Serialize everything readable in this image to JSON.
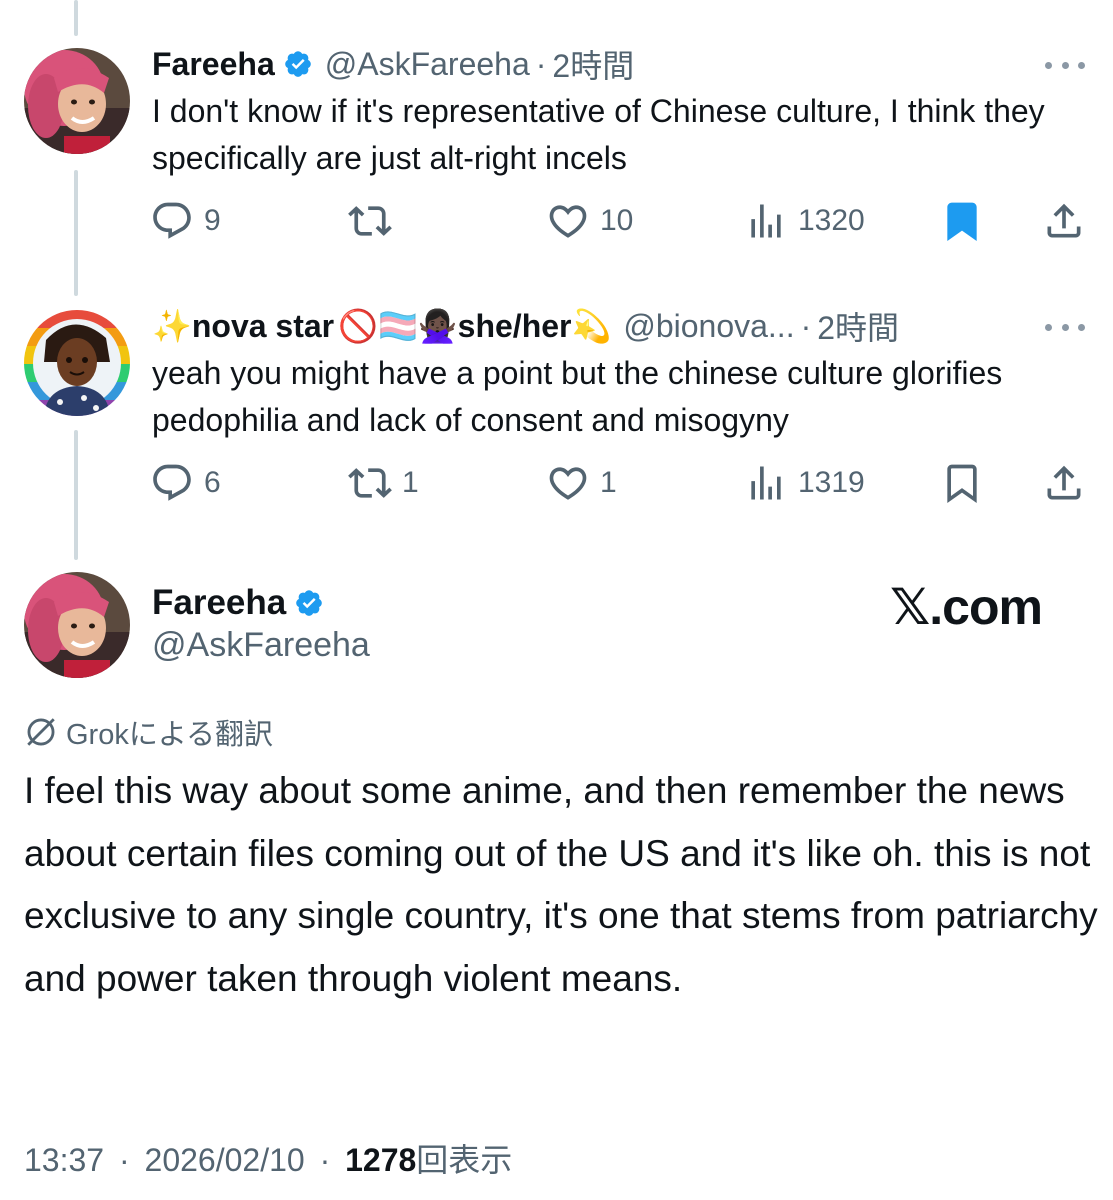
{
  "tweets": [
    {
      "name": "Fareeha",
      "handle": "@AskFareeha",
      "separator": "·",
      "time": "2時間",
      "text": "I don't know if it's representative of Chinese culture, I think they specifically are just alt-right incels",
      "replies": "9",
      "retweets": "",
      "likes": "10",
      "views": "1320",
      "bookmarked": true
    },
    {
      "name_prefix_emoji": "✨",
      "name": "nova star",
      "name_emojis": "🚫🏳️‍⚧️🙅🏿‍♀️",
      "pronouns": "she/her",
      "name_suffix_emoji": "💫",
      "handle": "@bionova...",
      "separator": "·",
      "time": "2時間",
      "text": "yeah you might have a point but the chinese culture glorifies pedophilia and lack of consent and misogyny",
      "replies": "6",
      "retweets": "1",
      "likes": "1",
      "views": "1319",
      "bookmarked": false
    }
  ],
  "focal": {
    "name": "Fareeha",
    "handle": "@AskFareeha",
    "watermark": "𝕏.com",
    "translation_label": "Grokによる翻訳",
    "text": "I feel this way about some anime, and then remember the news about certain files coming out of the US and it's like oh. this is not exclusive to any single country, it's one that stems from patriarchy and power taken through violent means.",
    "time": "13:37",
    "date": "2026/02/10",
    "separator": "·",
    "views_count": "1278",
    "views_label": "回表示"
  },
  "colors": {
    "verified": "#1d9bf0",
    "bookmark_active": "#1d9bf0",
    "secondary_text": "#536471",
    "thread_line": "#cfd9de"
  },
  "icons": [
    "verified-badge-icon",
    "more-icon",
    "reply-icon",
    "retweet-icon",
    "like-icon",
    "views-icon",
    "bookmark-icon",
    "share-icon",
    "grok-icon"
  ]
}
